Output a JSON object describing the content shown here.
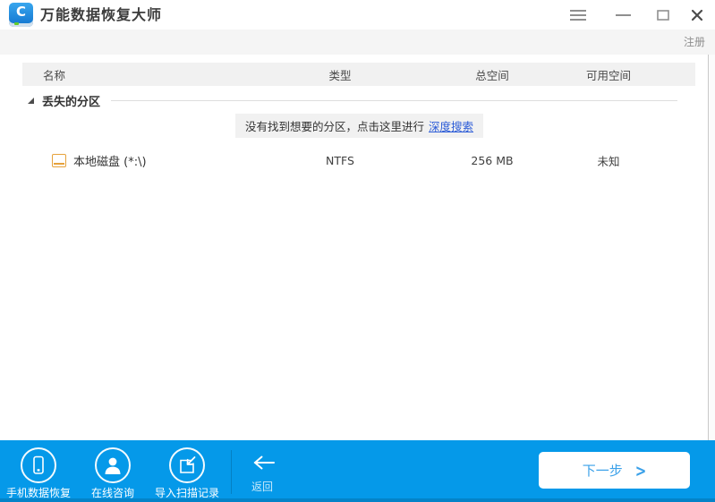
{
  "window": {
    "title": "万能数据恢复大师",
    "logo_letter": "C",
    "register_label": "注册"
  },
  "table": {
    "columns": [
      "名称",
      "类型",
      "总空间",
      "可用空间"
    ],
    "group_label": "丢失的分区",
    "notice": {
      "text": "没有找到想要的分区，点击这里进行",
      "link": "深度搜索"
    },
    "rows": [
      {
        "name": "本地磁盘 (*:\\)",
        "type": "NTFS",
        "total_space": "256 MB",
        "free_space": "未知"
      }
    ]
  },
  "toolbar": {
    "actions": [
      {
        "label": "手机数据恢复",
        "icon": "phone-icon"
      },
      {
        "label": "在线咨询",
        "icon": "person-icon"
      },
      {
        "label": "导入扫描记录",
        "icon": "import-icon"
      }
    ],
    "back_label": "返回",
    "next_label": "下一步",
    "next_chevron": ">"
  },
  "icons": {
    "app_logo": "blue-drive-with-C",
    "window_controls": [
      "menu-icon",
      "minimize-icon",
      "maximize-icon",
      "close-icon"
    ],
    "expander": "expanded-tree-triangle",
    "drive": "orange-drive-outline",
    "back": "left-arrow"
  },
  "colors": {
    "toolbar_blue": "#0599e9",
    "link_blue": "#2b5bd7",
    "drive_orange": "#e6a23c",
    "next_text_blue": "#3ba1e9",
    "header_bg": "#f1f1f1"
  }
}
